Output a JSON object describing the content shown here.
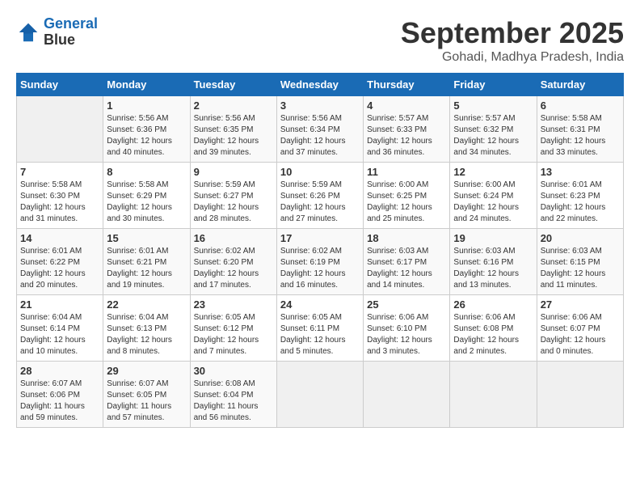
{
  "logo": {
    "line1": "General",
    "line2": "Blue"
  },
  "title": "September 2025",
  "location": "Gohadi, Madhya Pradesh, India",
  "weekdays": [
    "Sunday",
    "Monday",
    "Tuesday",
    "Wednesday",
    "Thursday",
    "Friday",
    "Saturday"
  ],
  "weeks": [
    [
      {
        "day": "",
        "sunrise": "",
        "sunset": "",
        "daylight": ""
      },
      {
        "day": "1",
        "sunrise": "Sunrise: 5:56 AM",
        "sunset": "Sunset: 6:36 PM",
        "daylight": "Daylight: 12 hours and 40 minutes."
      },
      {
        "day": "2",
        "sunrise": "Sunrise: 5:56 AM",
        "sunset": "Sunset: 6:35 PM",
        "daylight": "Daylight: 12 hours and 39 minutes."
      },
      {
        "day": "3",
        "sunrise": "Sunrise: 5:56 AM",
        "sunset": "Sunset: 6:34 PM",
        "daylight": "Daylight: 12 hours and 37 minutes."
      },
      {
        "day": "4",
        "sunrise": "Sunrise: 5:57 AM",
        "sunset": "Sunset: 6:33 PM",
        "daylight": "Daylight: 12 hours and 36 minutes."
      },
      {
        "day": "5",
        "sunrise": "Sunrise: 5:57 AM",
        "sunset": "Sunset: 6:32 PM",
        "daylight": "Daylight: 12 hours and 34 minutes."
      },
      {
        "day": "6",
        "sunrise": "Sunrise: 5:58 AM",
        "sunset": "Sunset: 6:31 PM",
        "daylight": "Daylight: 12 hours and 33 minutes."
      }
    ],
    [
      {
        "day": "7",
        "sunrise": "Sunrise: 5:58 AM",
        "sunset": "Sunset: 6:30 PM",
        "daylight": "Daylight: 12 hours and 31 minutes."
      },
      {
        "day": "8",
        "sunrise": "Sunrise: 5:58 AM",
        "sunset": "Sunset: 6:29 PM",
        "daylight": "Daylight: 12 hours and 30 minutes."
      },
      {
        "day": "9",
        "sunrise": "Sunrise: 5:59 AM",
        "sunset": "Sunset: 6:27 PM",
        "daylight": "Daylight: 12 hours and 28 minutes."
      },
      {
        "day": "10",
        "sunrise": "Sunrise: 5:59 AM",
        "sunset": "Sunset: 6:26 PM",
        "daylight": "Daylight: 12 hours and 27 minutes."
      },
      {
        "day": "11",
        "sunrise": "Sunrise: 6:00 AM",
        "sunset": "Sunset: 6:25 PM",
        "daylight": "Daylight: 12 hours and 25 minutes."
      },
      {
        "day": "12",
        "sunrise": "Sunrise: 6:00 AM",
        "sunset": "Sunset: 6:24 PM",
        "daylight": "Daylight: 12 hours and 24 minutes."
      },
      {
        "day": "13",
        "sunrise": "Sunrise: 6:01 AM",
        "sunset": "Sunset: 6:23 PM",
        "daylight": "Daylight: 12 hours and 22 minutes."
      }
    ],
    [
      {
        "day": "14",
        "sunrise": "Sunrise: 6:01 AM",
        "sunset": "Sunset: 6:22 PM",
        "daylight": "Daylight: 12 hours and 20 minutes."
      },
      {
        "day": "15",
        "sunrise": "Sunrise: 6:01 AM",
        "sunset": "Sunset: 6:21 PM",
        "daylight": "Daylight: 12 hours and 19 minutes."
      },
      {
        "day": "16",
        "sunrise": "Sunrise: 6:02 AM",
        "sunset": "Sunset: 6:20 PM",
        "daylight": "Daylight: 12 hours and 17 minutes."
      },
      {
        "day": "17",
        "sunrise": "Sunrise: 6:02 AM",
        "sunset": "Sunset: 6:19 PM",
        "daylight": "Daylight: 12 hours and 16 minutes."
      },
      {
        "day": "18",
        "sunrise": "Sunrise: 6:03 AM",
        "sunset": "Sunset: 6:17 PM",
        "daylight": "Daylight: 12 hours and 14 minutes."
      },
      {
        "day": "19",
        "sunrise": "Sunrise: 6:03 AM",
        "sunset": "Sunset: 6:16 PM",
        "daylight": "Daylight: 12 hours and 13 minutes."
      },
      {
        "day": "20",
        "sunrise": "Sunrise: 6:03 AM",
        "sunset": "Sunset: 6:15 PM",
        "daylight": "Daylight: 12 hours and 11 minutes."
      }
    ],
    [
      {
        "day": "21",
        "sunrise": "Sunrise: 6:04 AM",
        "sunset": "Sunset: 6:14 PM",
        "daylight": "Daylight: 12 hours and 10 minutes."
      },
      {
        "day": "22",
        "sunrise": "Sunrise: 6:04 AM",
        "sunset": "Sunset: 6:13 PM",
        "daylight": "Daylight: 12 hours and 8 minutes."
      },
      {
        "day": "23",
        "sunrise": "Sunrise: 6:05 AM",
        "sunset": "Sunset: 6:12 PM",
        "daylight": "Daylight: 12 hours and 7 minutes."
      },
      {
        "day": "24",
        "sunrise": "Sunrise: 6:05 AM",
        "sunset": "Sunset: 6:11 PM",
        "daylight": "Daylight: 12 hours and 5 minutes."
      },
      {
        "day": "25",
        "sunrise": "Sunrise: 6:06 AM",
        "sunset": "Sunset: 6:10 PM",
        "daylight": "Daylight: 12 hours and 3 minutes."
      },
      {
        "day": "26",
        "sunrise": "Sunrise: 6:06 AM",
        "sunset": "Sunset: 6:08 PM",
        "daylight": "Daylight: 12 hours and 2 minutes."
      },
      {
        "day": "27",
        "sunrise": "Sunrise: 6:06 AM",
        "sunset": "Sunset: 6:07 PM",
        "daylight": "Daylight: 12 hours and 0 minutes."
      }
    ],
    [
      {
        "day": "28",
        "sunrise": "Sunrise: 6:07 AM",
        "sunset": "Sunset: 6:06 PM",
        "daylight": "Daylight: 11 hours and 59 minutes."
      },
      {
        "day": "29",
        "sunrise": "Sunrise: 6:07 AM",
        "sunset": "Sunset: 6:05 PM",
        "daylight": "Daylight: 11 hours and 57 minutes."
      },
      {
        "day": "30",
        "sunrise": "Sunrise: 6:08 AM",
        "sunset": "Sunset: 6:04 PM",
        "daylight": "Daylight: 11 hours and 56 minutes."
      },
      {
        "day": "",
        "sunrise": "",
        "sunset": "",
        "daylight": ""
      },
      {
        "day": "",
        "sunrise": "",
        "sunset": "",
        "daylight": ""
      },
      {
        "day": "",
        "sunrise": "",
        "sunset": "",
        "daylight": ""
      },
      {
        "day": "",
        "sunrise": "",
        "sunset": "",
        "daylight": ""
      }
    ]
  ]
}
